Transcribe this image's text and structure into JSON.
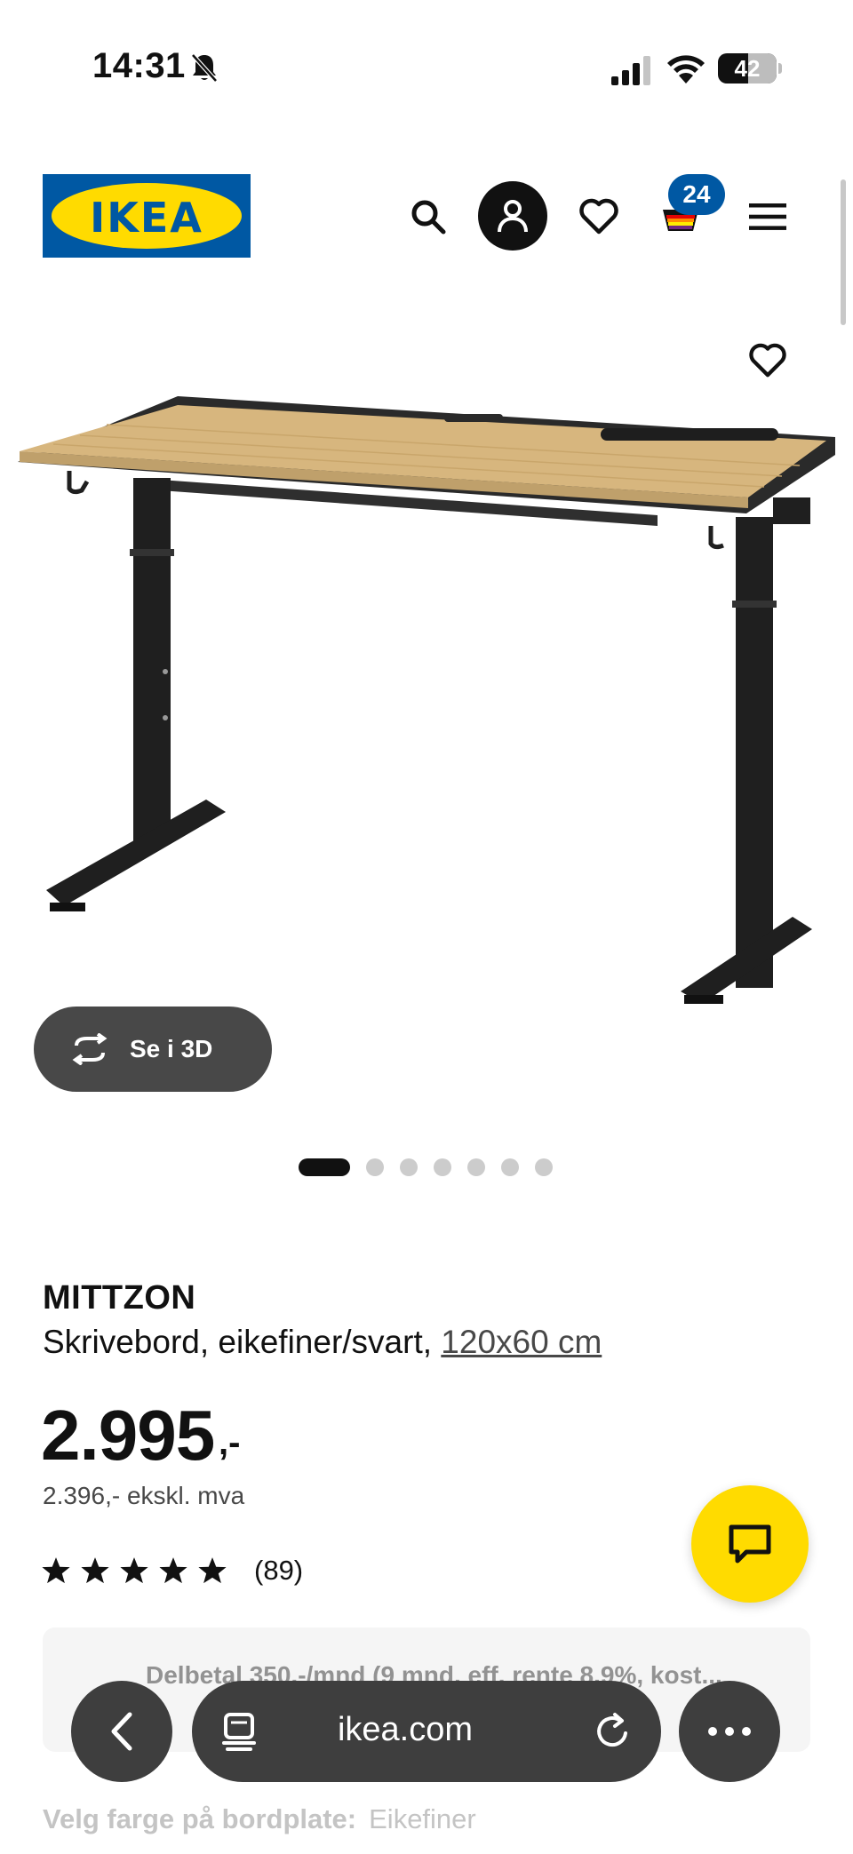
{
  "status_bar": {
    "time": "14:31",
    "battery": "42"
  },
  "header": {
    "logo_text": "IKEA",
    "cart_count": "24"
  },
  "gallery": {
    "view_3d_label": "Se i 3D",
    "image_count": 7,
    "active_index": 0
  },
  "product": {
    "name": "MITTZON",
    "description": "Skrivebord, eikefiner/svart, ",
    "size": "120x60 cm",
    "price": "2.995",
    "price_suffix": ",-",
    "price_ex_vat": "2.396,- ekskl. mva",
    "rating": 5,
    "review_count": "(89)"
  },
  "financing": {
    "text": "Delbetal 350,-/mnd (9 mnd, eff. rente 8.9%, kost..."
  },
  "browser": {
    "url": "ikea.com"
  },
  "color_option": {
    "label": "Velg farge på bordplate:",
    "value": "Eikefiner"
  },
  "colors": {
    "ikea_blue": "#0058a3",
    "ikea_yellow": "#ffdb00",
    "oak": "#d7b67e",
    "frame": "#1f1f1f"
  }
}
